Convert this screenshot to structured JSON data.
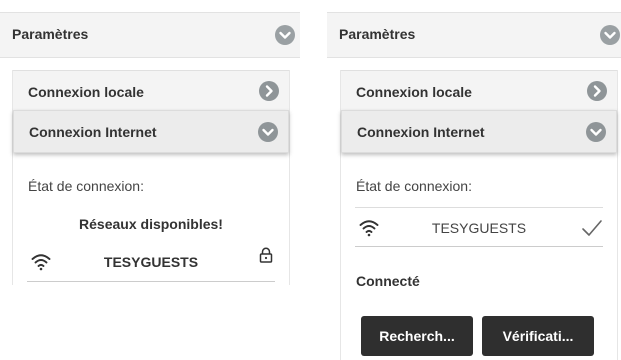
{
  "left": {
    "settings_title": "Paramètres",
    "rows": {
      "local": "Connexion locale",
      "internet": "Connexion Internet"
    },
    "status_label": "État de connexion:",
    "available_networks": "Réseaux disponibles!",
    "network": {
      "ssid": "TESYGUESTS",
      "icon": "wifi-icon",
      "secure_icon": "lock-icon"
    }
  },
  "right": {
    "settings_title": "Paramètres",
    "rows": {
      "local": "Connexion locale",
      "internet": "Connexion Internet"
    },
    "status_label": "État de connexion:",
    "network": {
      "ssid": "TESYGUESTS",
      "icon": "wifi-icon",
      "state_icon": "checkmark-icon"
    },
    "connected_label": "Connecté",
    "buttons": {
      "search": "Recherch...",
      "verify": "Vérificati..."
    }
  },
  "colors": {
    "header_bg": "#f4f4f4",
    "active_row_bg": "#ececec",
    "chevron_bg": "#8f9598",
    "button_bg": "#2f2f2f"
  }
}
